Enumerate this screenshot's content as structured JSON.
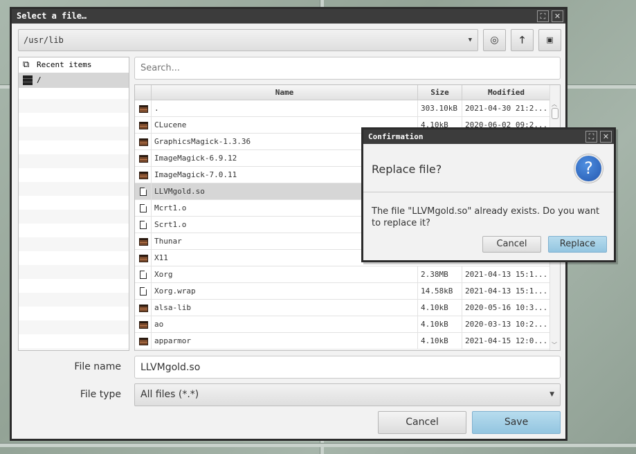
{
  "file_dialog": {
    "title": "Select a file…",
    "path": "/usr/lib",
    "search_placeholder": "Search...",
    "places": [
      {
        "label": "Recent items",
        "icon": "recent-items-icon"
      },
      {
        "label": "/",
        "icon": "drive-icon",
        "selected": true
      }
    ],
    "columns": {
      "name": "Name",
      "size": "Size",
      "modified": "Modified"
    },
    "files": [
      {
        "name": ".",
        "size": "303.10kB",
        "modified": "2021-04-30 21:2...",
        "type": "folder"
      },
      {
        "name": "CLucene",
        "size": "4.10kB",
        "modified": "2020-06-02 09:2...",
        "type": "folder"
      },
      {
        "name": "GraphicsMagick-1.3.36",
        "size": "",
        "modified": "",
        "type": "folder"
      },
      {
        "name": "ImageMagick-6.9.12",
        "size": "",
        "modified": "",
        "type": "folder"
      },
      {
        "name": "ImageMagick-7.0.11",
        "size": "",
        "modified": "",
        "type": "folder"
      },
      {
        "name": "LLVMgold.so",
        "size": "",
        "modified": "",
        "type": "file",
        "selected": true
      },
      {
        "name": "Mcrt1.o",
        "size": "",
        "modified": "",
        "type": "file"
      },
      {
        "name": "Scrt1.o",
        "size": "",
        "modified": "",
        "type": "file"
      },
      {
        "name": "Thunar",
        "size": "",
        "modified": "",
        "type": "folder"
      },
      {
        "name": "X11",
        "size": "",
        "modified": "",
        "type": "folder"
      },
      {
        "name": "Xorg",
        "size": "2.38MB",
        "modified": "2021-04-13 15:1...",
        "type": "file"
      },
      {
        "name": "Xorg.wrap",
        "size": "14.58kB",
        "modified": "2021-04-13 15:1...",
        "type": "file"
      },
      {
        "name": "alsa-lib",
        "size": "4.10kB",
        "modified": "2020-05-16 10:3...",
        "type": "folder"
      },
      {
        "name": "ao",
        "size": "4.10kB",
        "modified": "2020-03-13 10:2...",
        "type": "folder"
      },
      {
        "name": "apparmor",
        "size": "4.10kB",
        "modified": "2021-04-15 12:0...",
        "type": "folder"
      }
    ],
    "file_name_label": "File name",
    "file_name_value": "LLVMgold.so",
    "file_type_label": "File type",
    "file_type_value": "All files (*.*)",
    "cancel_label": "Cancel",
    "save_label": "Save"
  },
  "confirm_dialog": {
    "title": "Confirmation",
    "heading": "Replace file?",
    "message": "The file \"LLVMgold.so\" already exists. Do you want to replace it?",
    "cancel_label": "Cancel",
    "replace_label": "Replace",
    "icon": "question-icon"
  },
  "colors": {
    "accent": "#93c5e0",
    "titlebar": "#3c3c3c",
    "question": "#2f6fc4"
  }
}
